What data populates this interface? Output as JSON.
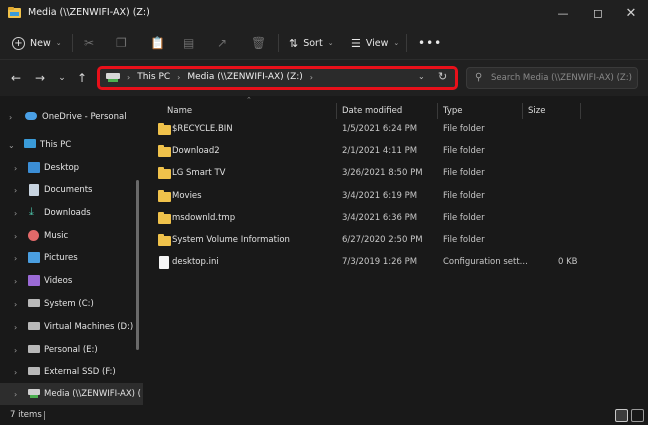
{
  "window": {
    "title": "Media (\\\\ZENWIFI-AX) (Z:)"
  },
  "toolbar": {
    "new_label": "New",
    "sort_label": "Sort",
    "view_label": "View"
  },
  "address": {
    "crumbs": [
      "This PC",
      "Media (\\\\ZENWIFI-AX) (Z:)"
    ]
  },
  "search": {
    "placeholder": "Search Media (\\\\ZENWIFI-AX) (Z:)"
  },
  "sidebar": {
    "items": [
      {
        "label": "OneDrive - Personal",
        "icon": "cloud-icon"
      },
      {
        "label": "This PC",
        "icon": "computer-icon"
      },
      {
        "label": "Desktop",
        "icon": "desktop-icon"
      },
      {
        "label": "Documents",
        "icon": "documents-icon"
      },
      {
        "label": "Downloads",
        "icon": "download-icon"
      },
      {
        "label": "Music",
        "icon": "music-icon"
      },
      {
        "label": "Pictures",
        "icon": "pictures-icon"
      },
      {
        "label": "Videos",
        "icon": "videos-icon"
      },
      {
        "label": "System (C:)",
        "icon": "drive-icon"
      },
      {
        "label": "Virtual Machines (D:)",
        "icon": "drive-icon"
      },
      {
        "label": "Personal (E:)",
        "icon": "drive-icon"
      },
      {
        "label": "External SSD (F:)",
        "icon": "drive-icon"
      },
      {
        "label": "Media (\\\\ZENWIFI-AX) (",
        "icon": "network-drive-icon"
      }
    ]
  },
  "table": {
    "columns": [
      "Name",
      "Date modified",
      "Type",
      "Size"
    ],
    "rows": [
      {
        "name": "$RECYCLE.BIN",
        "date": "1/5/2021 6:24 PM",
        "type": "File folder",
        "size": "",
        "kind": "folder"
      },
      {
        "name": "Download2",
        "date": "2/1/2021 4:11 PM",
        "type": "File folder",
        "size": "",
        "kind": "folder"
      },
      {
        "name": "LG Smart TV",
        "date": "3/26/2021 8:50 PM",
        "type": "File folder",
        "size": "",
        "kind": "folder"
      },
      {
        "name": "Movies",
        "date": "3/4/2021 6:19 PM",
        "type": "File folder",
        "size": "",
        "kind": "folder"
      },
      {
        "name": "msdownld.tmp",
        "date": "3/4/2021 6:36 PM",
        "type": "File folder",
        "size": "",
        "kind": "folder"
      },
      {
        "name": "System Volume Information",
        "date": "6/27/2020 2:50 PM",
        "type": "File folder",
        "size": "",
        "kind": "folder"
      },
      {
        "name": "desktop.ini",
        "date": "7/3/2019 1:26 PM",
        "type": "Configuration sett...",
        "size": "0 KB",
        "kind": "file"
      }
    ]
  },
  "status": {
    "item_count": "7 items"
  },
  "colors": {
    "highlight": "#e8101a",
    "folder": "#f0c24b",
    "background": "#191919"
  }
}
